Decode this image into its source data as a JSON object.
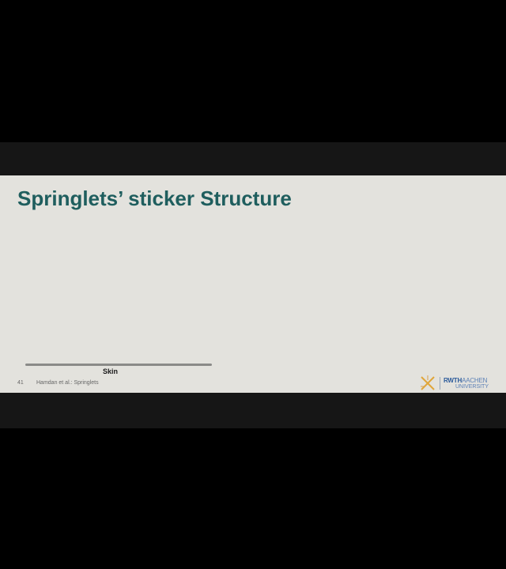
{
  "slide": {
    "title": "Springlets’ sticker Structure",
    "skin_label": "Skin",
    "page_number": "41",
    "footer_text": "Hamdan et al.: Springlets"
  },
  "logo": {
    "brand": "RWTH",
    "brand_suffix": "AACHEN",
    "subtitle": "UNIVERSITY",
    "accent_color": "#2b5a9a",
    "mark_color": "#e0a63a"
  },
  "colors": {
    "title": "#1f5e5e",
    "slide_background": "#e3e2dd",
    "frame_background": "#000000"
  }
}
